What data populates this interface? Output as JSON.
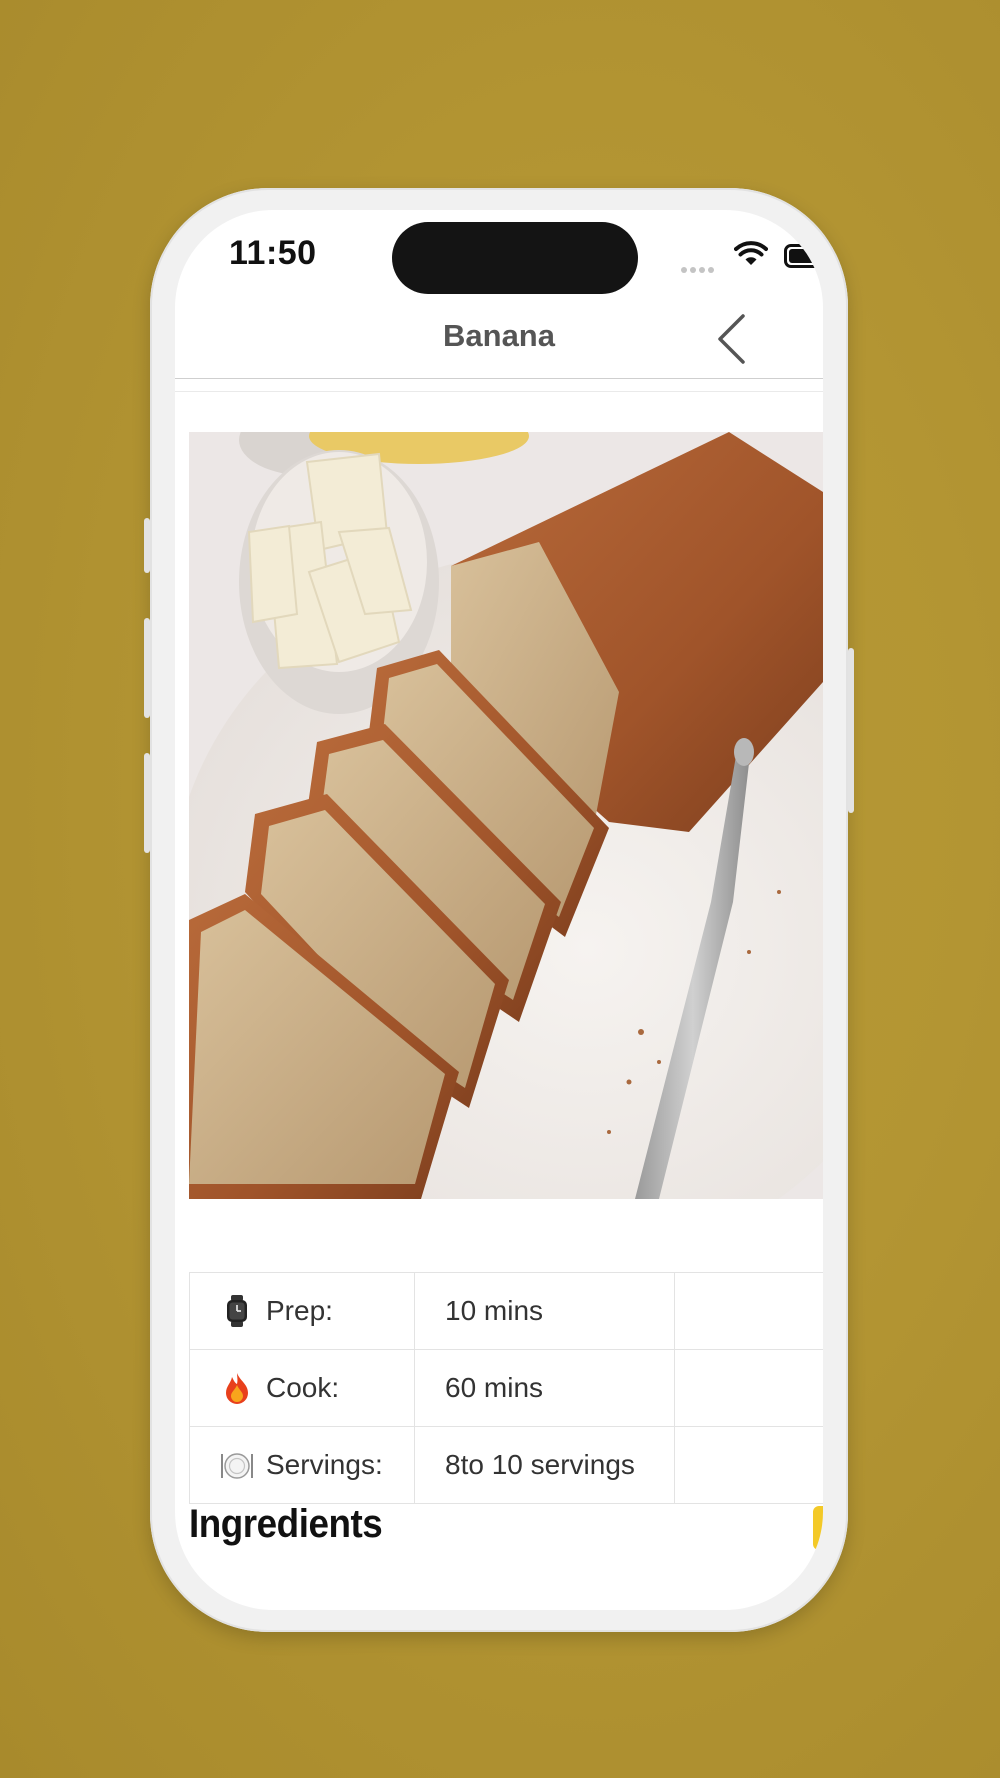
{
  "status_bar": {
    "time": "11:50"
  },
  "nav": {
    "title": "Banana"
  },
  "hero": {
    "alt": "Sliced banana bread loaf with butter and knife"
  },
  "info": [
    {
      "icon": "watch-icon",
      "label": "Prep:",
      "value": "10 mins"
    },
    {
      "icon": "fire-icon",
      "label": "Cook:",
      "value": "60 mins"
    },
    {
      "icon": "plate-icon",
      "label": "Servings:",
      "value": "8to 10 servings"
    }
  ],
  "section": {
    "ingredients_heading": "Ingredients"
  },
  "colors": {
    "background": "#b39533",
    "accent": "#f3c928"
  }
}
